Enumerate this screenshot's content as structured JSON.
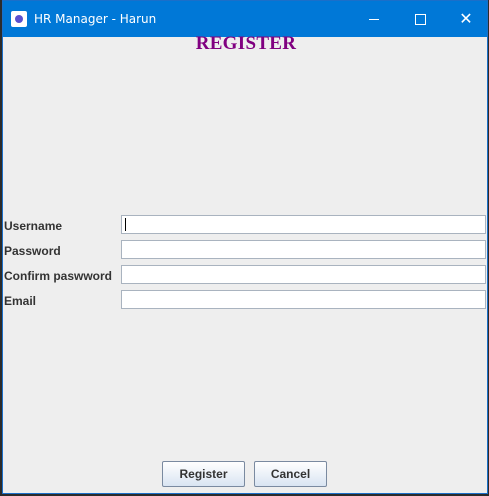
{
  "window": {
    "title": "HR Manager - Harun",
    "controls": {
      "minimize": "minimize-icon",
      "maximize": "maximize-icon",
      "close": "close-icon"
    }
  },
  "form": {
    "heading": "REGISTER",
    "fields": [
      {
        "label": "Username",
        "value": ""
      },
      {
        "label": "Password",
        "value": ""
      },
      {
        "label": "Confirm paswword",
        "value": ""
      },
      {
        "label": "Email",
        "value": ""
      }
    ]
  },
  "buttons": {
    "register": "Register",
    "cancel": "Cancel"
  },
  "colors": {
    "titlebar": "#0078d7",
    "heading": "#800080",
    "background": "#eeeeee"
  }
}
